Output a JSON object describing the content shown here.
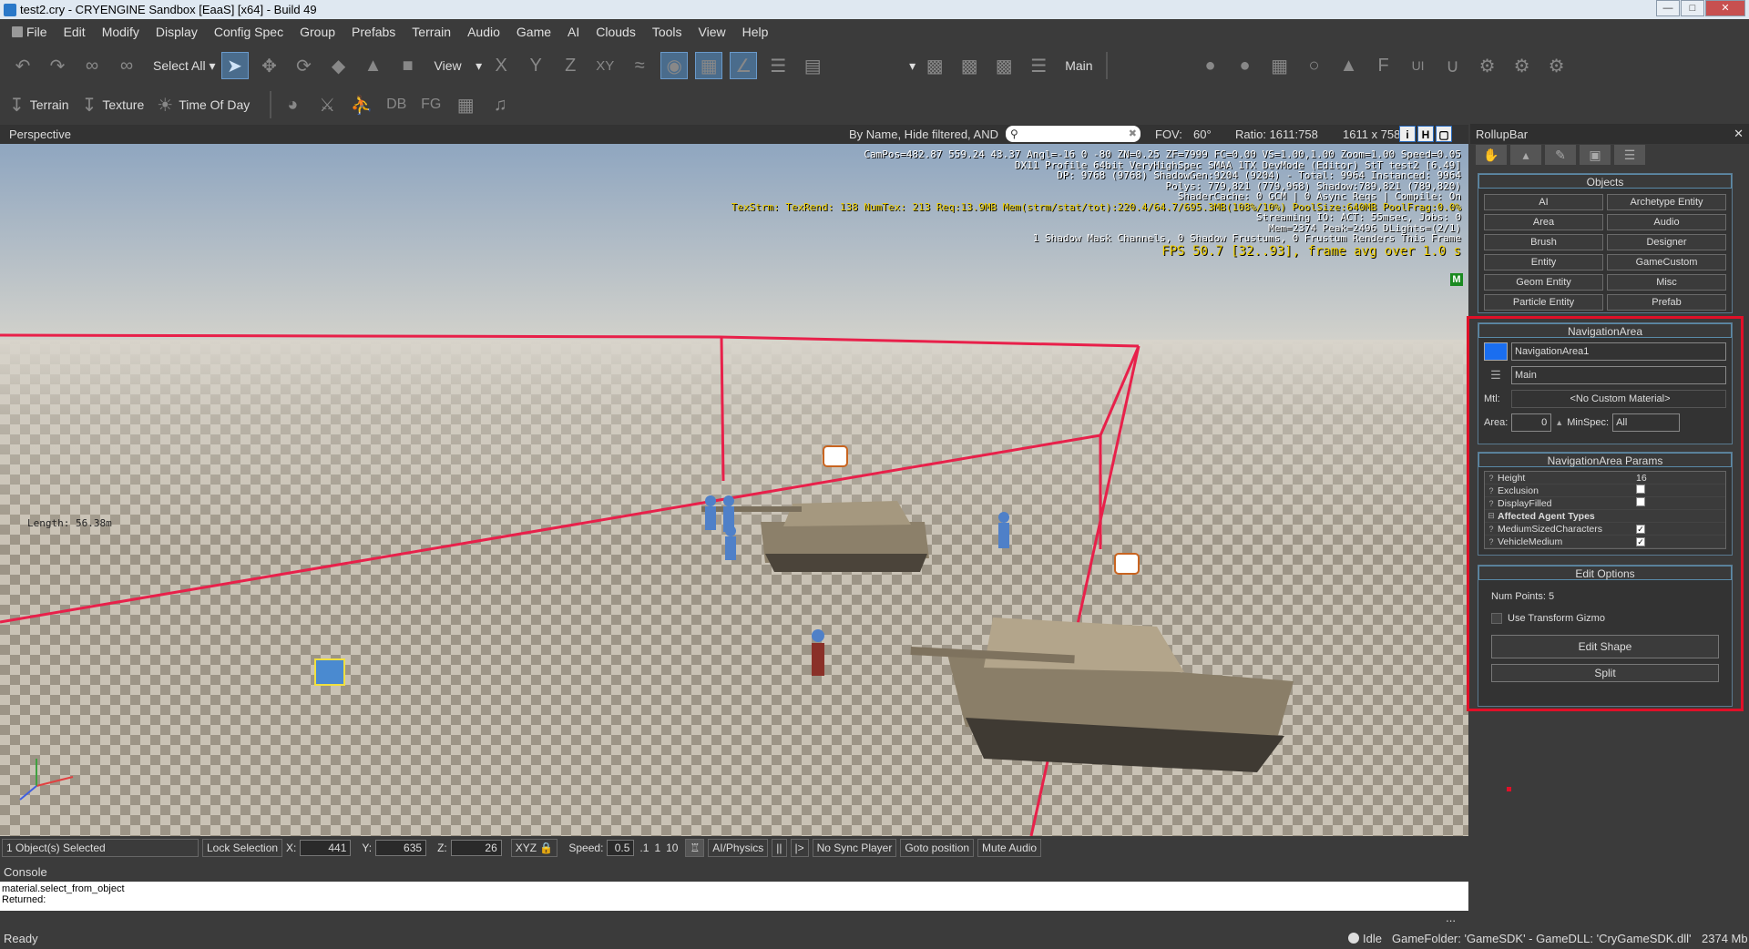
{
  "window": {
    "title": "test2.cry - CRYENGINE Sandbox [EaaS] [x64] - Build 49"
  },
  "menu": [
    "File",
    "Edit",
    "Modify",
    "Display",
    "Config Spec",
    "Group",
    "Prefabs",
    "Terrain",
    "Audio",
    "Game",
    "AI",
    "Clouds",
    "Tools",
    "View",
    "Help"
  ],
  "toolbar": {
    "select_all": "Select All",
    "view": "View",
    "axis": [
      "X",
      "Y",
      "Z",
      "XY"
    ],
    "layer": "Main"
  },
  "toolbar2": {
    "terrain": "Terrain",
    "texture": "Texture",
    "time_of_day": "Time Of Day",
    "db": "DB",
    "fg": "FG"
  },
  "viewport": {
    "name": "Perspective",
    "filter": "By Name, Hide filtered, AND",
    "fov_label": "FOV:",
    "fov_value": "60°",
    "ratio": "Ratio: 1611:758",
    "resolution": "1611 x 758",
    "stats": [
      "CamPos=482.87 559.24 43.37 Angl=-16  0 -80 ZN=0.25 ZF=7999 FC=0.00 VS=1.00,1.00 Zoom=1.00 Speed=0.05",
      "DX11 Profile 64bit VeryHighSpec SMAA 1TX DevMode (Editor) StT test2 [6.49]",
      "DP: 9768 (9768) ShadowGen:9204 (9204) - Total: 9964 Instanced: 9964",
      "Polys: 779,821 (779,968) Shadow:789,821 (789,820)",
      "ShaderCache: 0 GCM | 0 Async Reqs | Compile: On",
      "TexStrm: TexRend: 138 NumTex: 213 Req:13.9MB Mem(strm/stat/tot):220.4/64.7/695.3MB(108%/10%) PoolSize:640MB PoolFrag:0.0%",
      "Streaming IO: ACT:  55msec, Jobs: 0",
      "Mem=2374 Peak=2496 DLights=(2/1)",
      "1 Shadow Mask Channels,   0 Shadow Frustums,   0 Frustum Renders This Frame",
      "FPS 50.7 [32..93], frame avg over 1.0 s"
    ],
    "mbadge": "M",
    "length_label": "Length: 56.38m"
  },
  "statusrow": {
    "selected": "1 Object(s) Selected",
    "lock": "Lock Selection",
    "x_label": "X:",
    "x": "441",
    "y_label": "Y:",
    "y": "635",
    "z_label": "Z:",
    "z": "26",
    "xyz": "XYZ",
    "speed_label": "Speed:",
    "speed": "0.5",
    "speed_presets": [
      ".1",
      "1",
      "10"
    ],
    "ai_physics": "AI/Physics",
    "no_sync": "No Sync Player",
    "goto": "Goto position",
    "mute": "Mute Audio"
  },
  "console": {
    "title": "Console",
    "lines": [
      "material.select_from_object",
      "Returned:"
    ],
    "more": "..."
  },
  "status": {
    "ready": "Ready",
    "idle": "Idle",
    "game_folder": "GameFolder: 'GameSDK' - GameDLL: 'CryGameSDK.dll'",
    "mem": "2374 Mb"
  },
  "rollup": {
    "title": "RollupBar",
    "objects_title": "Objects",
    "objects": [
      "AI",
      "Archetype Entity",
      "Area",
      "Audio",
      "Brush",
      "Designer",
      "Entity",
      "GameCustom",
      "Geom Entity",
      "Misc",
      "Particle Entity",
      "Prefab"
    ],
    "nav_title": "NavigationArea",
    "nav_name": "NavigationArea1",
    "nav_layer": "Main",
    "mtl_label": "Mtl:",
    "mtl_value": "<No Custom Material>",
    "area_label": "Area:",
    "area_value": "0",
    "minspec_label": "MinSpec:",
    "minspec_value": "All",
    "params_title": "NavigationArea Params",
    "params": [
      {
        "name": "Height",
        "value": "16",
        "type": "text"
      },
      {
        "name": "Exclusion",
        "value": "",
        "type": "check",
        "checked": false
      },
      {
        "name": "DisplayFilled",
        "value": "",
        "type": "check",
        "checked": false
      },
      {
        "name": "Affected Agent Types",
        "value": "",
        "type": "group"
      },
      {
        "name": "MediumSizedCharacters",
        "value": "",
        "type": "check",
        "checked": true
      },
      {
        "name": "VehicleMedium",
        "value": "",
        "type": "check",
        "checked": true
      }
    ],
    "edit_title": "Edit Options",
    "num_points": "Num Points: 5",
    "use_gizmo": "Use Transform Gizmo",
    "edit_shape": "Edit Shape",
    "split": "Split"
  },
  "colors": {
    "highlight": "#e01028",
    "nav_swatch": "#1a6ef0"
  }
}
